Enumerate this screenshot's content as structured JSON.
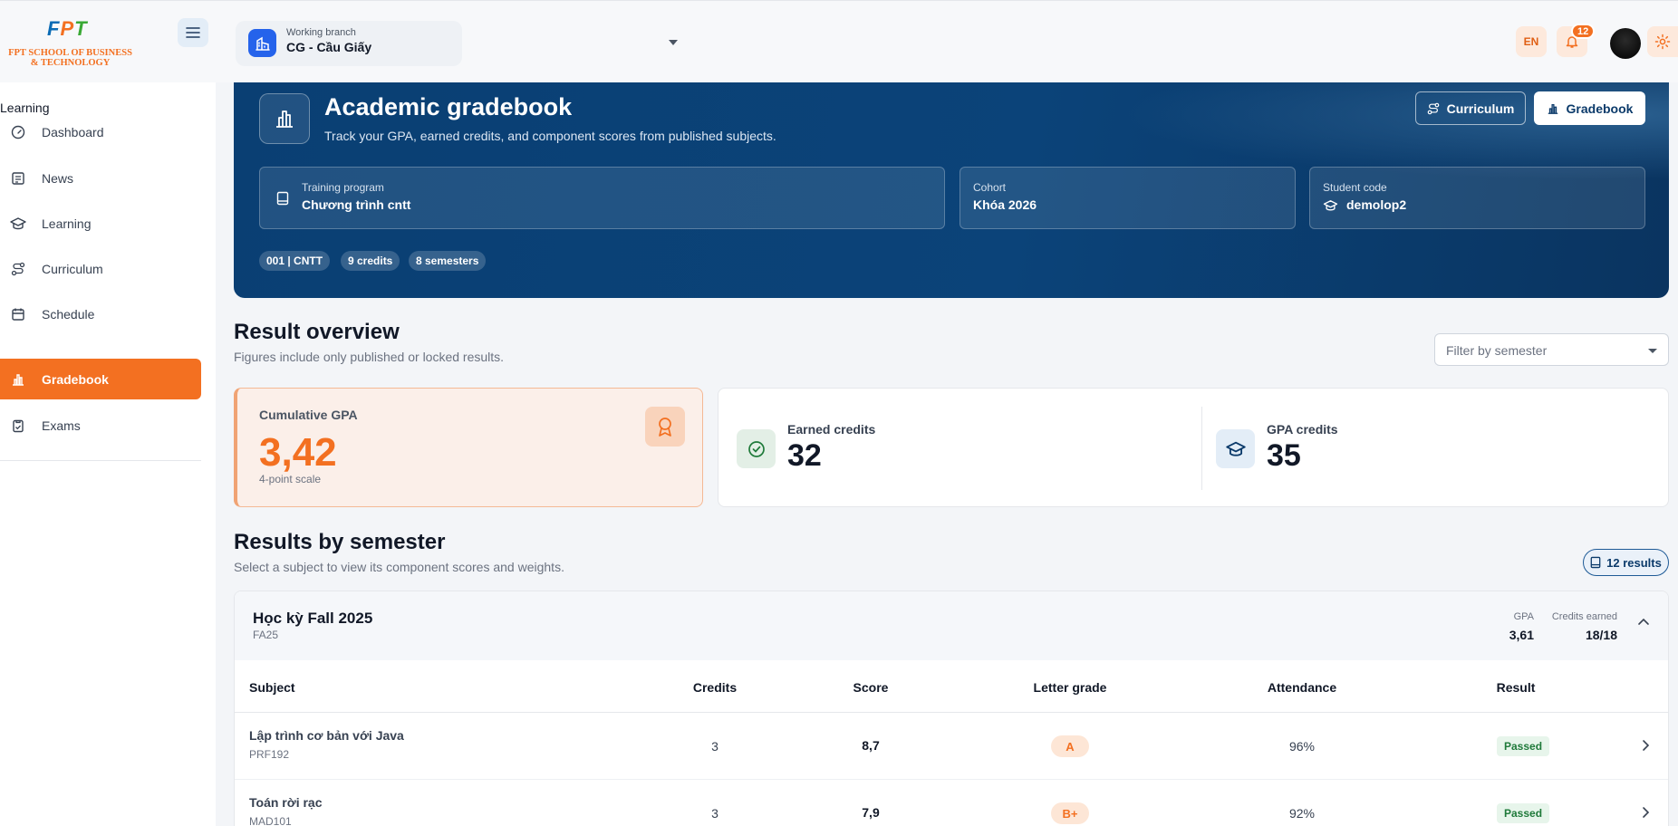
{
  "header": {
    "logo_text": "FPT",
    "school_line1": "FPT SCHOOL OF BUSINESS",
    "school_line2": "& TECHNOLOGY",
    "branch_label": "Working branch",
    "branch_value": "CG - Cầu Giấy",
    "lang": "EN",
    "notification_count": "12"
  },
  "sidebar": {
    "section": "Learning",
    "items": [
      {
        "label": "Dashboard",
        "icon": "dashboard-icon"
      },
      {
        "label": "News",
        "icon": "news-icon"
      },
      {
        "label": "Learning",
        "icon": "graduation-cap-icon"
      },
      {
        "label": "Curriculum",
        "icon": "route-icon"
      },
      {
        "label": "Schedule",
        "icon": "calendar-icon"
      },
      {
        "label": "Gradebook",
        "icon": "bar-chart-icon",
        "active": true
      },
      {
        "label": "Exams",
        "icon": "clipboard-icon"
      }
    ]
  },
  "hero": {
    "title": "Academic gradebook",
    "subtitle": "Track your GPA, earned credits, and component scores from published subjects.",
    "btn_curriculum": "Curriculum",
    "btn_gradebook": "Gradebook",
    "program_label": "Training program",
    "program_value": "Chương trình cntt",
    "cohort_label": "Cohort",
    "cohort_value": "Khóa 2026",
    "student_label": "Student code",
    "student_value": "demolop2",
    "chips": [
      "001 | CNTT",
      "9 credits",
      "8 semesters"
    ]
  },
  "overview": {
    "title": "Result overview",
    "subtitle": "Figures include only published or locked results.",
    "filter_placeholder": "Filter by semester",
    "gpa_label": "Cumulative GPA",
    "gpa_value": "3,42",
    "gpa_scale": "4-point scale",
    "earned_label": "Earned credits",
    "earned_value": "32",
    "gpa_credits_label": "GPA credits",
    "gpa_credits_value": "35"
  },
  "semesters": {
    "title": "Results by semester",
    "subtitle": "Select a subject to view its component scores and weights.",
    "results_badge": "12 results",
    "semester": {
      "name": "Học kỳ Fall 2025",
      "code": "FA25",
      "gpa_label": "GPA",
      "gpa_value": "3,61",
      "credits_label": "Credits earned",
      "credits_value": "18/18"
    },
    "columns": [
      "Subject",
      "Credits",
      "Score",
      "Letter grade",
      "Attendance",
      "Result"
    ],
    "rows": [
      {
        "subject": "Lập trình cơ bản với Java",
        "code": "PRF192",
        "credits": "3",
        "score": "8,7",
        "letter": "A",
        "attendance": "96%",
        "result": "Passed"
      },
      {
        "subject": "Toán rời rạc",
        "code": "MAD101",
        "credits": "3",
        "score": "7,9",
        "letter": "B+",
        "attendance": "92%",
        "result": "Passed"
      }
    ]
  },
  "colors": {
    "accent": "#f37021",
    "navy": "#0b4379",
    "success": "#1f7a3a"
  }
}
